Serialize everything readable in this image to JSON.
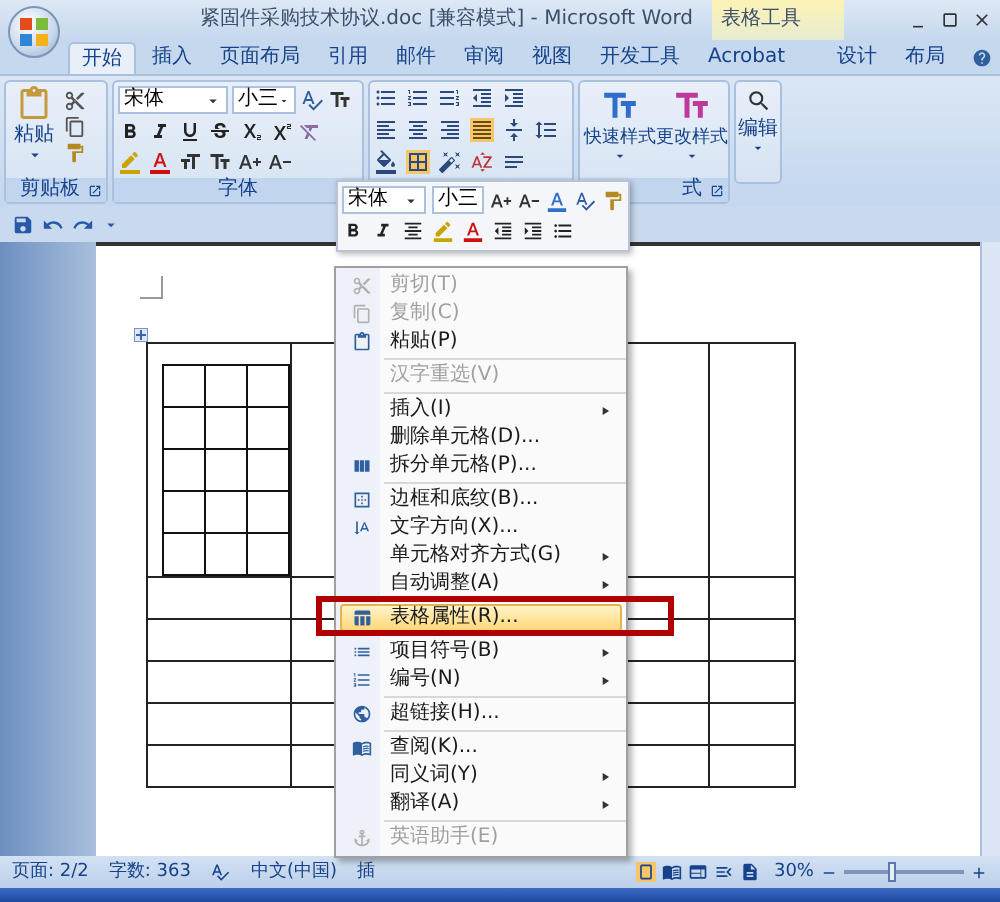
{
  "window": {
    "title": "紧固件采购技术协议.doc [兼容模式] - Microsoft Word",
    "context_label": "表格工具"
  },
  "tabs": [
    {
      "label": "开始",
      "selected": true
    },
    {
      "label": "插入",
      "selected": false
    },
    {
      "label": "页面布局",
      "selected": false
    },
    {
      "label": "引用",
      "selected": false
    },
    {
      "label": "邮件",
      "selected": false
    },
    {
      "label": "审阅",
      "selected": false
    },
    {
      "label": "视图",
      "selected": false
    },
    {
      "label": "开发工具",
      "selected": false
    },
    {
      "label": "Acrobat",
      "selected": false
    },
    {
      "label": "设计",
      "selected": false
    },
    {
      "label": "布局",
      "selected": false
    }
  ],
  "ribbon": {
    "clipboard": {
      "paste": "粘贴",
      "label": "剪贴板"
    },
    "font": {
      "font_name": "宋体",
      "font_size": "小三",
      "label": "字体"
    },
    "styles": {
      "quick_styles": "快速样式",
      "change_styles": "更改样式",
      "label": "式"
    },
    "editing": {
      "label": "编辑"
    }
  },
  "mini_toolbar": {
    "font_name": "宋体",
    "font_size": "小三"
  },
  "context_menu": {
    "items": [
      {
        "kind": "item",
        "label": "剪切(T)",
        "disabled": true,
        "selected": false,
        "submenu": false
      },
      {
        "kind": "item",
        "label": "复制(C)",
        "disabled": true,
        "selected": false,
        "submenu": false
      },
      {
        "kind": "item",
        "label": "粘贴(P)",
        "disabled": false,
        "selected": false,
        "submenu": false
      },
      {
        "kind": "separator"
      },
      {
        "kind": "item",
        "label": "汉字重选(V)",
        "disabled": true,
        "selected": false,
        "submenu": false
      },
      {
        "kind": "separator"
      },
      {
        "kind": "item",
        "label": "插入(I)",
        "disabled": false,
        "selected": false,
        "submenu": true
      },
      {
        "kind": "item",
        "label": "删除单元格(D)...",
        "disabled": false,
        "selected": false,
        "submenu": false
      },
      {
        "kind": "item",
        "label": "拆分单元格(P)...",
        "disabled": false,
        "selected": false,
        "submenu": false
      },
      {
        "kind": "separator"
      },
      {
        "kind": "item",
        "label": "边框和底纹(B)...",
        "disabled": false,
        "selected": false,
        "submenu": false
      },
      {
        "kind": "item",
        "label": "文字方向(X)...",
        "disabled": false,
        "selected": false,
        "submenu": false
      },
      {
        "kind": "item",
        "label": "单元格对齐方式(G)",
        "disabled": false,
        "selected": false,
        "submenu": true
      },
      {
        "kind": "item",
        "label": "自动调整(A)",
        "disabled": false,
        "selected": false,
        "submenu": true
      },
      {
        "kind": "separator"
      },
      {
        "kind": "item",
        "label": "表格属性(R)...",
        "disabled": false,
        "selected": true,
        "submenu": false
      },
      {
        "kind": "separator"
      },
      {
        "kind": "item",
        "label": "项目符号(B)",
        "disabled": false,
        "selected": false,
        "submenu": true
      },
      {
        "kind": "item",
        "label": "编号(N)",
        "disabled": false,
        "selected": false,
        "submenu": true
      },
      {
        "kind": "separator"
      },
      {
        "kind": "item",
        "label": "超链接(H)...",
        "disabled": false,
        "selected": false,
        "submenu": false
      },
      {
        "kind": "separator"
      },
      {
        "kind": "item",
        "label": "查阅(K)...",
        "disabled": false,
        "selected": false,
        "submenu": false
      },
      {
        "kind": "item",
        "label": "同义词(Y)",
        "disabled": false,
        "selected": false,
        "submenu": true
      },
      {
        "kind": "item",
        "label": "翻译(A)",
        "disabled": false,
        "selected": false,
        "submenu": true
      },
      {
        "kind": "separator"
      },
      {
        "kind": "item",
        "label": "英语助手(E)",
        "disabled": true,
        "selected": false,
        "submenu": false
      }
    ]
  },
  "status_bar": {
    "page": "页面: 2/2",
    "words": "字数: 363",
    "language": "中文(中国)",
    "mode": "插",
    "zoom": "30%",
    "zoom_slider": {
      "level": 0.4
    }
  }
}
